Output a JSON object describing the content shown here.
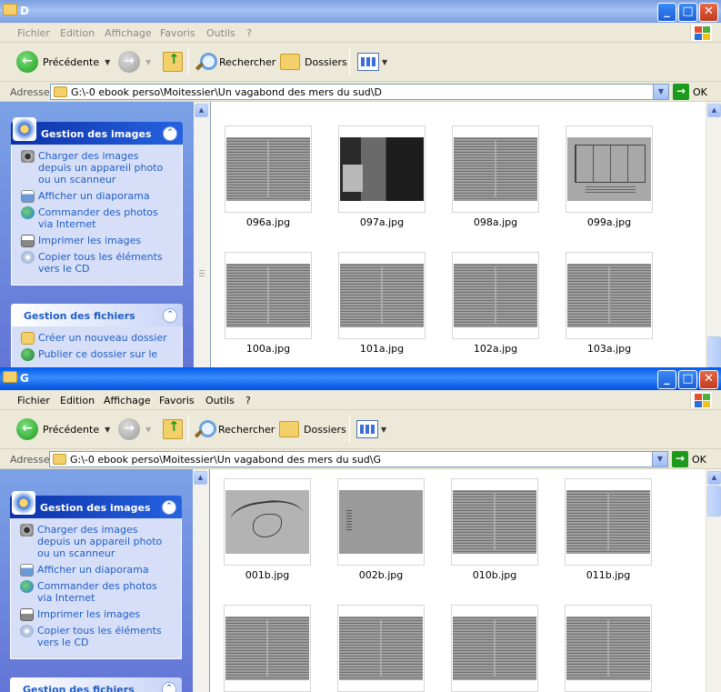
{
  "common": {
    "menu": [
      "Fichier",
      "Edition",
      "Affichage",
      "Favoris",
      "Outils",
      "?"
    ],
    "toolbar": {
      "back_label": "Précédente",
      "search_label": "Rechercher",
      "folders_label": "Dossiers"
    },
    "address_label": "Adresse",
    "go_label": "OK",
    "image_tasks": {
      "title": "Gestion des images",
      "items": [
        "Charger des images depuis un appareil photo ou un scanneur",
        "Afficher un diaporama",
        "Commander des photos via Internet",
        "Imprimer les images",
        "Copier tous les éléments vers le CD"
      ]
    },
    "file_tasks": {
      "title": "Gestion des fichiers",
      "items": [
        "Créer un nouveau dossier",
        "Publier ce dossier sur le"
      ]
    },
    "colors": {
      "titlebar_active": "#0058ee",
      "titlebar_inactive": "#7b9fe0",
      "taskpane": "#6f8fdf",
      "link": "#215dc6"
    }
  },
  "window_d": {
    "title": "D",
    "active": false,
    "address": "G:\\-0 ebook perso\\Moitessier\\Un vagabond des mers du sud\\D",
    "files": [
      {
        "name": "096a.jpg",
        "thumb": "text"
      },
      {
        "name": "097a.jpg",
        "thumb": "photo"
      },
      {
        "name": "098a.jpg",
        "thumb": "text"
      },
      {
        "name": "099a.jpg",
        "thumb": "diag"
      },
      {
        "name": "100a.jpg",
        "thumb": "text"
      },
      {
        "name": "101a.jpg",
        "thumb": "text"
      },
      {
        "name": "102a.jpg",
        "thumb": "text"
      },
      {
        "name": "103a.jpg",
        "thumb": "text"
      }
    ]
  },
  "window_g": {
    "title": "G",
    "active": true,
    "address": "G:\\-0 ebook perso\\Moitessier\\Un vagabond des mers du sud\\G",
    "files": [
      {
        "name": "001b.jpg",
        "thumb": "map"
      },
      {
        "name": "002b.jpg",
        "thumb": "blank"
      },
      {
        "name": "010b.jpg",
        "thumb": "text"
      },
      {
        "name": "011b.jpg",
        "thumb": "text"
      },
      {
        "name": "",
        "thumb": "text"
      },
      {
        "name": "",
        "thumb": "text"
      },
      {
        "name": "",
        "thumb": "text"
      },
      {
        "name": "",
        "thumb": "text"
      }
    ]
  }
}
